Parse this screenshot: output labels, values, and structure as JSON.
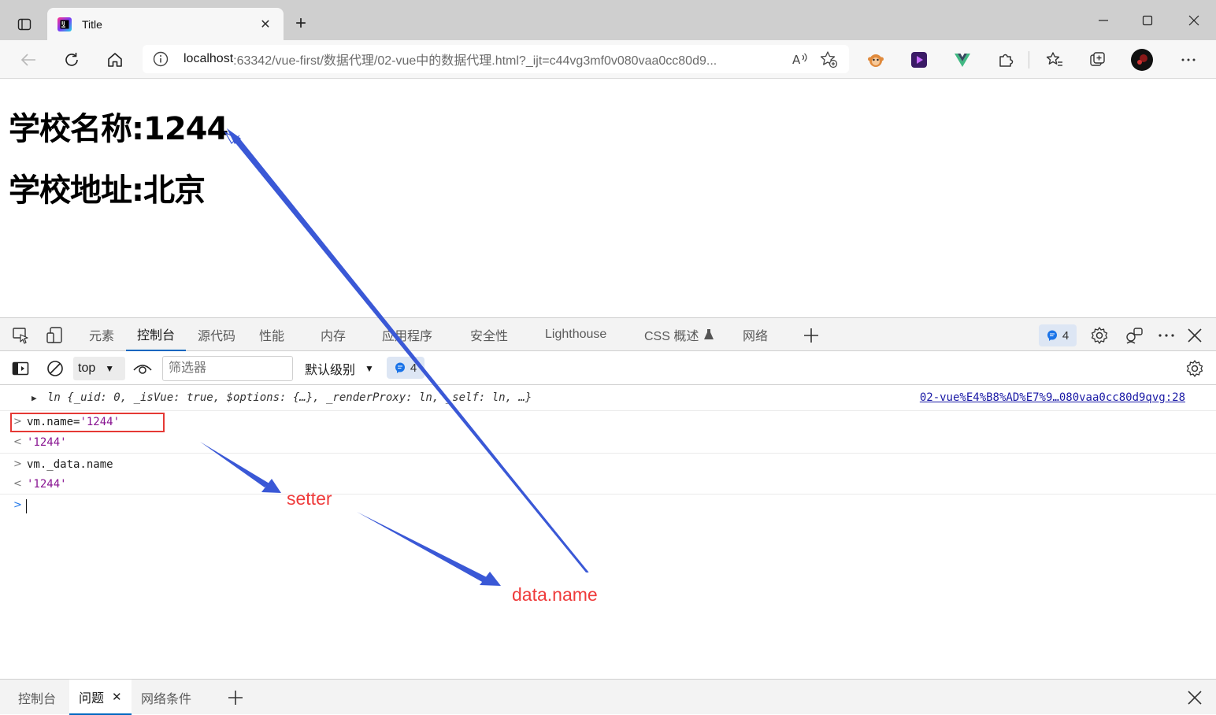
{
  "browser": {
    "tab": {
      "title": "Title"
    },
    "address": {
      "host": "localhost",
      "rest": ":63342/vue-first/数据代理/02-vue中的数据代理.html?_ijt=c44vg3mf0v080vaa0cc80d9..."
    }
  },
  "page": {
    "headings": [
      "学校名称:1244",
      "学校地址:北京"
    ]
  },
  "devtools": {
    "tabs": [
      "元素",
      "控制台",
      "源代码",
      "性能",
      "内存",
      "应用程序",
      "安全性",
      "Lighthouse",
      "CSS 概述",
      "网络"
    ],
    "active_tab": "控制台",
    "issue_count": "4",
    "console_toolbar": {
      "context": "top",
      "filter_placeholder": "筛选器",
      "level": "默认级别",
      "message_count": "4"
    },
    "console": {
      "object_log": {
        "text": "ln {_uid: 0, _isVue: true, $options: {…}, _renderProxy: ln, _self: ln, …}",
        "source": "02-vue%E4%B8%AD%E7%9…080vaa0cc80d9qvg:28"
      },
      "lines": [
        {
          "type": "input",
          "code": "vm.name=",
          "value": "'1244'"
        },
        {
          "type": "output",
          "value": "'1244'"
        },
        {
          "type": "input",
          "code": "vm._data.name",
          "value": ""
        },
        {
          "type": "output",
          "value": "'1244'"
        }
      ]
    },
    "drawer": {
      "tabs": [
        "控制台",
        "问题",
        "网络条件"
      ],
      "active_tab": "问题"
    }
  },
  "annotations": {
    "labels": [
      "setter",
      "data.name"
    ],
    "arrow_color": "#3a58d6",
    "label_color": "#ef3b3b",
    "box_color": "#e53935"
  }
}
